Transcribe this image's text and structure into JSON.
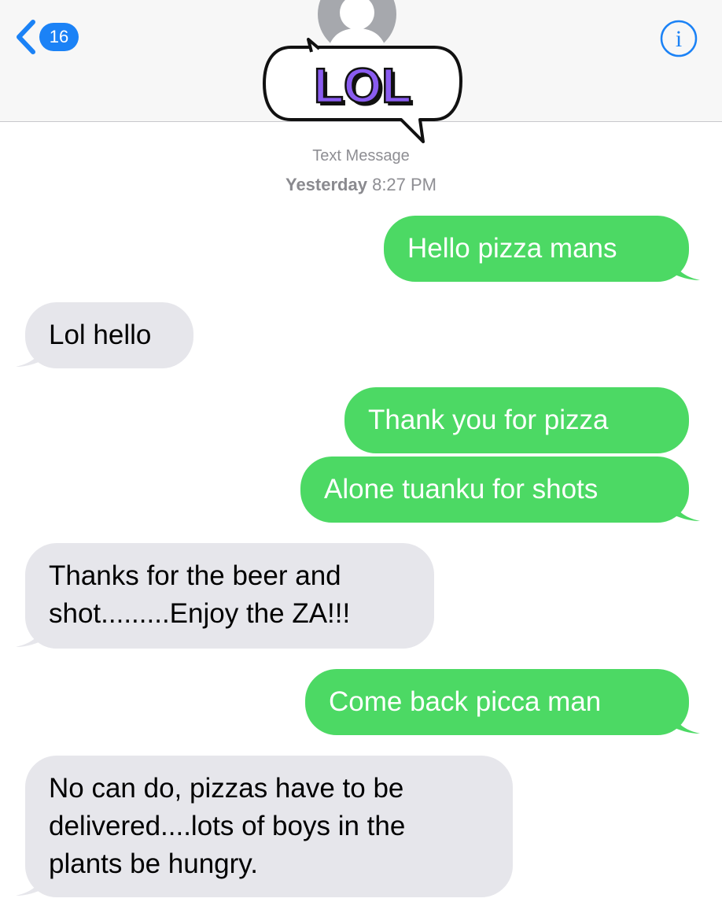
{
  "header": {
    "back_count": "16",
    "sticker_text": "LOL"
  },
  "thread": {
    "label": "Text Message",
    "day": "Yesterday",
    "time": "8:27 PM"
  },
  "messages": [
    {
      "dir": "sent",
      "text": "Hello pizza mans"
    },
    {
      "dir": "received",
      "text": "Lol hello"
    },
    {
      "dir": "sent",
      "text": "Thank you for pizza"
    },
    {
      "dir": "sent",
      "text": "Alone tuanku for shots"
    },
    {
      "dir": "received",
      "lines": [
        "Thanks for the beer and",
        "shot.........Enjoy the ZA!!!"
      ]
    },
    {
      "dir": "sent",
      "text": "Come back picca man"
    },
    {
      "dir": "received",
      "lines": [
        "No can do, pizzas have to be",
        "delivered....lots of boys in the",
        "plants be hungry."
      ]
    }
  ],
  "colors": {
    "sent_bubble": "#4cd964",
    "received_bubble": "#e6e6eb",
    "ios_blue": "#1b82f6",
    "sticker_purple": "#8a5cf0",
    "sticker_green": "#a6e8b4"
  },
  "icons": [
    "back-chevron-icon",
    "info-icon",
    "contact-avatar-icon",
    "lol-sticker"
  ]
}
